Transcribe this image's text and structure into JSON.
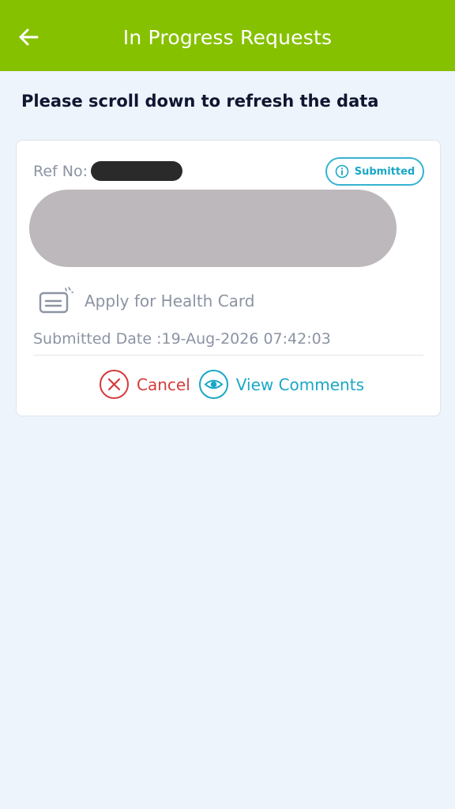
{
  "header": {
    "title": "In Progress Requests",
    "back_icon": "arrow-left-icon",
    "background": "#86c100"
  },
  "hint": "Please scroll down to refresh the data",
  "request": {
    "ref_label": "Ref No:",
    "status": "Submitted",
    "service_name": "Apply for Health Card",
    "submitted_date": "Submitted Date :19-Aug-2026 07:42:03",
    "cancel_label": "Cancel",
    "view_comments_label": "View Comments"
  },
  "colors": {
    "accent_green": "#86c100",
    "status_blue": "#1aa7c6",
    "cancel_red": "#d63a3a"
  }
}
